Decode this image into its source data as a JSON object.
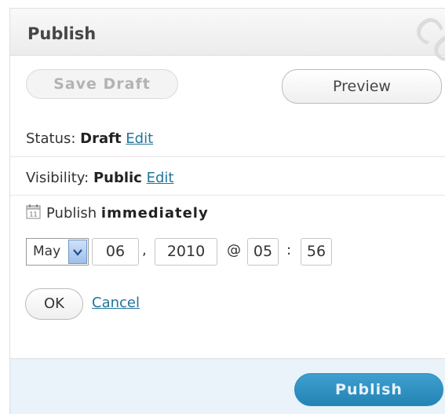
{
  "publish_box": {
    "title": "Publish",
    "save_draft_label": "Save Draft",
    "preview_label": "Preview",
    "status": {
      "label": "Status:",
      "value": "Draft",
      "edit_link": "Edit"
    },
    "visibility": {
      "label": "Visibility:",
      "value": "Public",
      "edit_link": "Edit"
    },
    "schedule": {
      "label": "Publish",
      "value": "immediately",
      "month": "May",
      "day": "06",
      "comma": ",",
      "year": "2010",
      "at": "@",
      "hour": "05",
      "colon": ":",
      "minute": "56",
      "ok_label": "OK",
      "cancel_link": "Cancel"
    },
    "publish_label": "Publish"
  },
  "watermark_text": "co",
  "colors": {
    "link": "#21759b",
    "publish_button": "#2384b4",
    "footer_bg": "#eaf2fa",
    "header_bg": "#ececec"
  },
  "icons": [
    "calendar-icon",
    "dropdown-arrow-icon"
  ]
}
